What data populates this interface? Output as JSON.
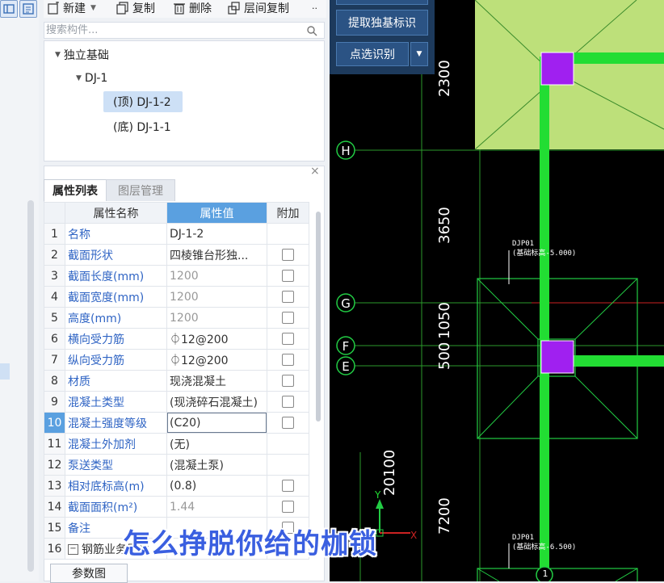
{
  "toolbar": {
    "new_label": "新建",
    "copy_label": "复制",
    "delete_label": "删除",
    "floor_copy_label": "层间复制",
    "more_label": "··"
  },
  "search": {
    "placeholder": "搜索构件..."
  },
  "tree": {
    "root": "独立基础",
    "child": "DJ-1",
    "leaf_top": "(顶) DJ-1-2",
    "leaf_bottom": "(底) DJ-1-1"
  },
  "panel": {
    "close": "×",
    "tabs": [
      "属性列表",
      "图层管理"
    ],
    "columns": [
      "属性名称",
      "属性值",
      "附加"
    ],
    "rows": [
      {
        "n": "1",
        "name": "名称",
        "value": "DJ-1-2",
        "checkbox": false
      },
      {
        "n": "2",
        "name": "截面形状",
        "value": "四棱锥台形独...",
        "checkbox": true
      },
      {
        "n": "3",
        "name": "截面长度(mm)",
        "value": "1200",
        "checkbox": true
      },
      {
        "n": "4",
        "name": "截面宽度(mm)",
        "value": "1200",
        "checkbox": true
      },
      {
        "n": "5",
        "name": "高度(mm)",
        "value": "1200",
        "checkbox": true
      },
      {
        "n": "6",
        "name": "横向受力筋",
        "value": "⏀12@200",
        "checkbox": true
      },
      {
        "n": "7",
        "name": "纵向受力筋",
        "value": "⏀12@200",
        "checkbox": true
      },
      {
        "n": "8",
        "name": "材质",
        "value": "现浇混凝土",
        "checkbox": true
      },
      {
        "n": "9",
        "name": "混凝土类型",
        "value": "(现浇碎石混凝土)",
        "checkbox": true
      },
      {
        "n": "10",
        "name": "混凝土强度等级",
        "value": "(C20)",
        "checkbox": true
      },
      {
        "n": "11",
        "name": "混凝土外加剂",
        "value": "(无)",
        "checkbox": false
      },
      {
        "n": "12",
        "name": "泵送类型",
        "value": "(混凝土泵)",
        "checkbox": false
      },
      {
        "n": "13",
        "name": "相对底标高(m)",
        "value": "(0.8)",
        "checkbox": true
      },
      {
        "n": "14",
        "name": "截面面积(m²)",
        "value": "1.44",
        "checkbox": true
      },
      {
        "n": "15",
        "name": "备注",
        "value": "",
        "checkbox": true
      },
      {
        "n": "16",
        "name": "钢筋业务属性",
        "value": "",
        "checkbox": false
      }
    ],
    "row16_toggle": "−",
    "param_button": "参数图"
  },
  "cad": {
    "extract_button": "提取独基标识",
    "point_button": "点选识别",
    "axis_labels": [
      "H",
      "G",
      "F",
      "E"
    ],
    "dims": [
      "2300",
      "3650",
      "1050",
      "500",
      "20100",
      "7200"
    ],
    "tag1_line1": "DJP01",
    "tag1_line2": "(基础标高-5.000)",
    "tag2_line1": "DJP01",
    "tag2_line2": "(基础标高-6.500)",
    "ucs_y": "Y",
    "ucs_x": "X",
    "axis_bottom": "1"
  },
  "subtitle": "怎么挣脱你给的枷锁",
  "colors": {
    "cad_bg": "#000000",
    "column_magenta": "#a020f0",
    "beam_green": "#22dd33",
    "foundation_fill": "#bde07a",
    "table_header_highlight": "#5aa0e0",
    "attr_name_blue": "#2f64c4"
  }
}
